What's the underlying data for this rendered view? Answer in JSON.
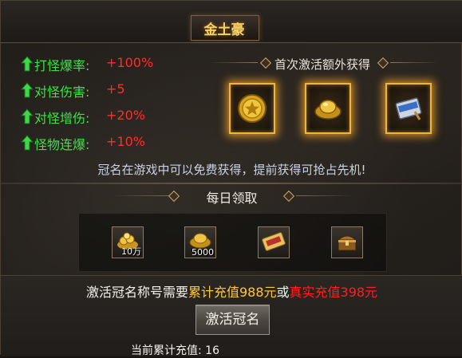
{
  "title": "金土豪",
  "stats": [
    {
      "label": "打怪爆率:",
      "value": "+100%"
    },
    {
      "label": "对怪伤害:",
      "value": "+5"
    },
    {
      "label": "对怪增伤:",
      "value": "+20%"
    },
    {
      "label": "怪物连爆:",
      "value": "+10%"
    }
  ],
  "first_activation": {
    "header": "首次激活额外获得",
    "rewards": [
      "gold-coin-icon",
      "gold-ingot-icon",
      "exp-scroll-icon"
    ]
  },
  "free_note": "冠名在游戏中可以免费获得，提前获得可抢占先机!",
  "daily": {
    "title": "每日领取",
    "items": [
      {
        "icon": "gold-pile-icon",
        "qty": "10万"
      },
      {
        "icon": "gold-ingot-icon",
        "qty": "5000"
      },
      {
        "icon": "ticket-icon",
        "qty": ""
      },
      {
        "icon": "treasure-chest-icon",
        "qty": ""
      }
    ]
  },
  "requirement": {
    "prefix": "激活冠名称号需要",
    "cumulative": "累计充值988元",
    "or": "或",
    "real": "真实充值398元"
  },
  "activate_button": "激活冠名",
  "current_recharge": "当前累计充值: 16",
  "colors": {
    "stat_label": "#3fe04a",
    "stat_value": "#ff2d2d",
    "cumulative": "#ffc83a",
    "real": "#ff2020",
    "title": "#f6d36a"
  }
}
